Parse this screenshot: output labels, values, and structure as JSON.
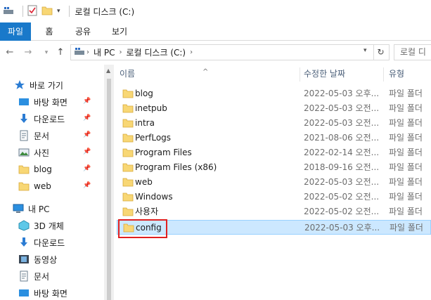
{
  "window": {
    "title": "로컬 디스크 (C:)"
  },
  "ribbon": {
    "tabs": [
      "파일",
      "홈",
      "공유",
      "보기"
    ]
  },
  "address": {
    "segments": [
      "내 PC",
      "로컬 디스크 (C:)"
    ],
    "search_placeholder": "로컬 디"
  },
  "nav_pane": {
    "quick_access": "바로 가기",
    "quick_items": [
      "바탕 화면",
      "다운로드",
      "문서",
      "사진",
      "blog",
      "web"
    ],
    "this_pc": "내 PC",
    "pc_items": [
      "3D 개체",
      "다운로드",
      "동영상",
      "문서",
      "바탕 화면"
    ]
  },
  "columns": {
    "name": "이름",
    "date": "수정한 날짜",
    "type": "유형"
  },
  "files": [
    {
      "name": "blog",
      "date": "2022-05-03 오후...",
      "type": "파일 폴더"
    },
    {
      "name": "inetpub",
      "date": "2022-05-03 오전...",
      "type": "파일 폴더"
    },
    {
      "name": "intra",
      "date": "2022-05-03 오전...",
      "type": "파일 폴더"
    },
    {
      "name": "PerfLogs",
      "date": "2021-08-06 오전...",
      "type": "파일 폴더"
    },
    {
      "name": "Program Files",
      "date": "2022-02-14 오전...",
      "type": "파일 폴더"
    },
    {
      "name": "Program Files (x86)",
      "date": "2018-09-16 오전...",
      "type": "파일 폴더"
    },
    {
      "name": "web",
      "date": "2022-05-03 오전...",
      "type": "파일 폴더"
    },
    {
      "name": "Windows",
      "date": "2022-05-02 오전...",
      "type": "파일 폴더"
    },
    {
      "name": "사용자",
      "date": "2022-05-02 오전...",
      "type": "파일 폴더"
    },
    {
      "name": "config",
      "date": "2022-05-03 오후...",
      "type": "파일 폴더"
    }
  ],
  "colors": {
    "file_tab": "#1979ca",
    "selection": "#cce8ff",
    "selection_border": "#99d1ff",
    "folder": "#f8d775",
    "highlight": "#e02020"
  }
}
